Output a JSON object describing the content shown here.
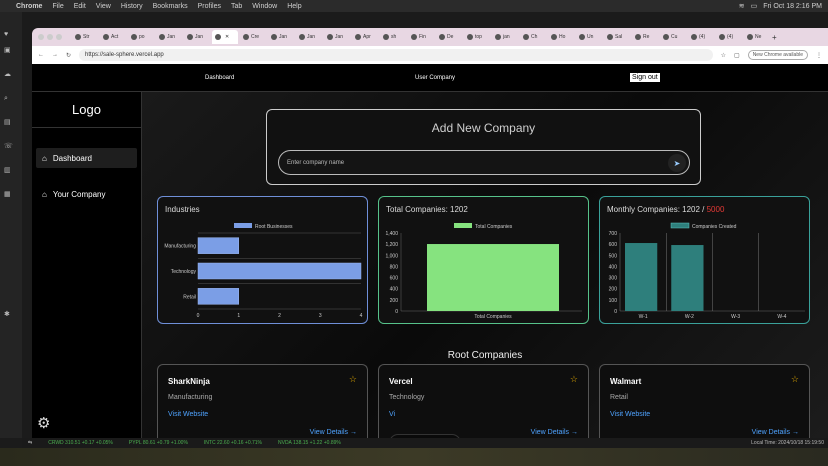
{
  "mac_bar": {
    "app": "Chrome",
    "menus": [
      "File",
      "Edit",
      "View",
      "History",
      "Bookmarks",
      "Profiles",
      "Tab",
      "Window",
      "Help"
    ],
    "clock": "Fri Oct 18  2:16 PM"
  },
  "browser": {
    "tabs": [
      "Str",
      "Act",
      "po",
      "Jan",
      "Jan",
      "",
      "Cre",
      "Jan",
      "Jan",
      "Jan",
      "Apr",
      "sh",
      "Fin",
      "De",
      "top",
      "jan",
      "Ch",
      "Ho",
      "Un",
      "Sal",
      "Re",
      "Cu",
      "(4)",
      "(4)",
      "Ne"
    ],
    "url": "https://sale-sphere.vercel.app",
    "new_chrome": "New Chrome available"
  },
  "nav": {
    "dashboard": "Dashboard",
    "user_company": "User Company",
    "sign_out": "Sign out"
  },
  "sidebar": {
    "logo": "Logo",
    "items": [
      {
        "label": "Dashboard"
      },
      {
        "label": "Your Company"
      }
    ]
  },
  "add_company": {
    "title": "Add New Company",
    "placeholder": "Enter company name"
  },
  "charts": {
    "industries_title": "Industries",
    "total_title": "Total Companies: 1202",
    "monthly_title_prefix": "Monthly Companies: 1202 / ",
    "monthly_title_limit": "5000"
  },
  "chart_data": [
    {
      "type": "bar",
      "orientation": "horizontal",
      "title": "Industries",
      "categories": [
        "Manufacturing",
        "Technology",
        "Retail"
      ],
      "series": [
        {
          "name": "Root Businesses",
          "values": [
            1,
            4,
            1
          ]
        }
      ],
      "xlim": [
        0,
        4
      ],
      "xticks": [
        "0",
        "1",
        "2",
        "3",
        "4"
      ],
      "color": "#7b9ee6"
    },
    {
      "type": "bar",
      "title": "Total Companies: 1202",
      "categories": [
        "Total Companies"
      ],
      "series": [
        {
          "name": "Total Companies",
          "values": [
            1202
          ]
        }
      ],
      "ylim": [
        0,
        1400
      ],
      "yticks": [
        "0",
        "200",
        "400",
        "600",
        "800",
        "1,000",
        "1,200",
        "1,400"
      ],
      "color": "#86e37f"
    },
    {
      "type": "bar",
      "title": "Monthly Companies: 1202 / 5000",
      "categories": [
        "W-1",
        "W-2",
        "W-3",
        "W-4"
      ],
      "series": [
        {
          "name": "Companies Created",
          "values": [
            610,
            592,
            0,
            0
          ]
        }
      ],
      "ylim": [
        0,
        700
      ],
      "yticks": [
        "0",
        "100",
        "200",
        "300",
        "400",
        "500",
        "600",
        "700"
      ],
      "color": "#2e7f7c"
    }
  ],
  "root_companies": {
    "title": "Root Companies",
    "items": [
      {
        "name": "SharkNinja",
        "industry": "Manufacturing",
        "website": "Visit Website",
        "details": "View Details →"
      },
      {
        "name": "Vercel",
        "industry": "Technology",
        "website": "Vi",
        "details": "View Details →"
      },
      {
        "name": "Walmart",
        "industry": "Retail",
        "website": "Visit Website",
        "details": "View Details →"
      }
    ]
  },
  "ticker": {
    "items": [
      "CRWD 310.51 +0.17 +0.05%",
      "PYPL 80.61 +0.79 +1.00%",
      "INTC 22.60 +0.16 +0.71%",
      "NVDA 138.15 +1.22 +0.89%"
    ],
    "local_time": "Local Time: 2024/10/18 15:19:50"
  }
}
